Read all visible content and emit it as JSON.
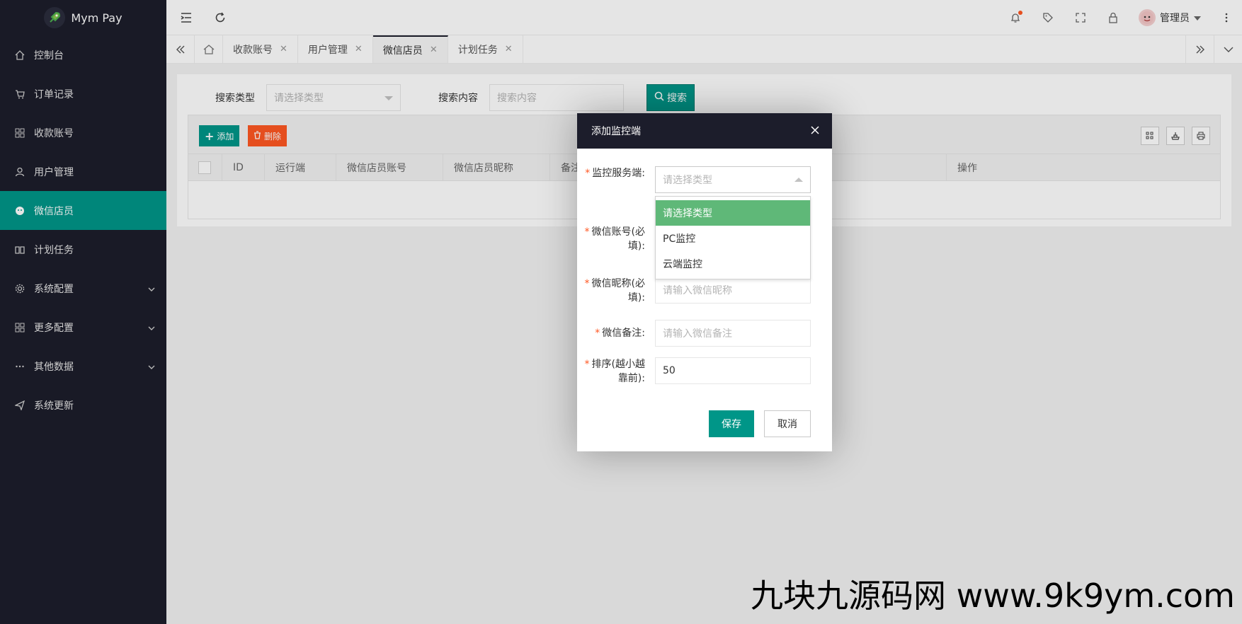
{
  "app": {
    "title": "Mym Pay"
  },
  "sidebar": {
    "items": [
      {
        "label": "控制台",
        "icon": "home-icon"
      },
      {
        "label": "订单记录",
        "icon": "cart-icon"
      },
      {
        "label": "收款账号",
        "icon": "grid-icon"
      },
      {
        "label": "用户管理",
        "icon": "user-icon"
      },
      {
        "label": "微信店员",
        "icon": "wechat-icon",
        "active": true
      },
      {
        "label": "计划任务",
        "icon": "book-icon"
      },
      {
        "label": "系统配置",
        "icon": "gear-icon",
        "expandable": true
      },
      {
        "label": "更多配置",
        "icon": "apps-icon",
        "expandable": true
      },
      {
        "label": "其他数据",
        "icon": "more-icon",
        "expandable": true
      },
      {
        "label": "系统更新",
        "icon": "send-icon"
      }
    ]
  },
  "topbar": {
    "user_name": "管理员"
  },
  "tabs": [
    {
      "label": "收款账号"
    },
    {
      "label": "用户管理"
    },
    {
      "label": "微信店员",
      "active": true
    },
    {
      "label": "计划任务"
    }
  ],
  "search": {
    "type_label": "搜索类型",
    "type_placeholder": "请选择类型",
    "content_label": "搜索内容",
    "content_placeholder": "搜索内容",
    "button_label": "搜索"
  },
  "toolbar": {
    "add_label": "添加",
    "delete_label": "删除"
  },
  "table": {
    "columns": [
      "ID",
      "运行端",
      "微信店员账号",
      "微信店员昵称",
      "备注",
      "操作"
    ]
  },
  "dialog": {
    "title": "添加监控端",
    "fields": {
      "server_label": "监控服务端:",
      "server_placeholder": "请选择类型",
      "account_label": "微信账号(必填):",
      "nickname_label": "微信昵称(必填):",
      "nickname_placeholder": "请输入微信昵称",
      "remark_label": "微信备注:",
      "remark_placeholder": "请输入微信备注",
      "sort_label": "排序(越小越靠前):",
      "sort_value": "50"
    },
    "dropdown_options": [
      "请选择类型",
      "PC监控",
      "云端监控"
    ],
    "save_label": "保存",
    "cancel_label": "取消"
  },
  "watermark": "九块九源码网 www.9k9ym.com",
  "colors": {
    "sidebar_bg": "#1c1d2b",
    "primary": "#009688",
    "danger": "#ff5722",
    "selected_option": "#5fb878"
  }
}
